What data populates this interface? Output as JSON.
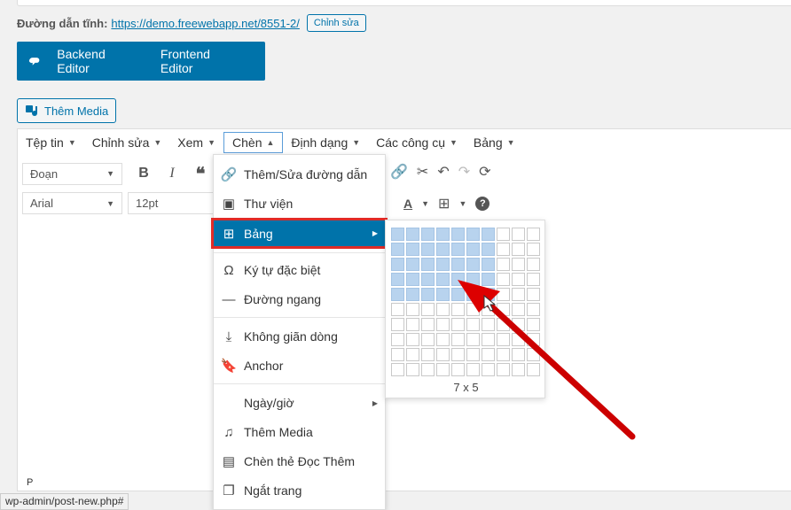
{
  "permalink": {
    "label": "Đường dẫn tĩnh:",
    "url": "https://demo.freewebapp.net/8551-2/",
    "edit_button": "Chỉnh sửa"
  },
  "builder": {
    "backend": "Backend Editor",
    "frontend": "Frontend Editor"
  },
  "media_button": "Thêm Media",
  "menubar": [
    {
      "label": "Tệp tin"
    },
    {
      "label": "Chỉnh sửa"
    },
    {
      "label": "Xem"
    },
    {
      "label": "Chèn"
    },
    {
      "label": "Định dạng"
    },
    {
      "label": "Các công cụ"
    },
    {
      "label": "Bảng"
    }
  ],
  "toolbar": {
    "paragraph": "Đoạn",
    "font_family": "Arial",
    "font_size": "12pt"
  },
  "insert_menu": [
    {
      "label": "Thêm/Sửa đường dẫn",
      "icon": "link-icon"
    },
    {
      "label": "Thư viện",
      "icon": "gallery-icon"
    },
    {
      "label": "Bảng",
      "icon": "table-icon"
    },
    {
      "label": "Ký tự đặc biệt",
      "icon": "omega-icon"
    },
    {
      "label": "Đường ngang",
      "icon": "horizontal-line-icon"
    },
    {
      "label": "Không giãn dòng",
      "icon": "nonbreaking-icon"
    },
    {
      "label": "Anchor",
      "icon": "bookmark-icon"
    },
    {
      "label": "Ngày/giờ",
      "icon": ""
    },
    {
      "label": "Thêm Media",
      "icon": "media-icon"
    },
    {
      "label": "Chèn thẻ Đọc Thêm",
      "icon": "read-more-icon"
    },
    {
      "label": "Ngắt trang",
      "icon": "page-break-icon"
    }
  ],
  "table_grid": {
    "label": "7 x 5",
    "cols_selected": 7,
    "rows_selected": 5,
    "total_cols": 10,
    "total_rows": 10
  },
  "status_path": "P",
  "url_tooltip": "wp-admin/post-new.php#",
  "colors": {
    "accent": "#0073aa",
    "highlight": "#e02b27",
    "grid_on": "#b8d3ee"
  }
}
